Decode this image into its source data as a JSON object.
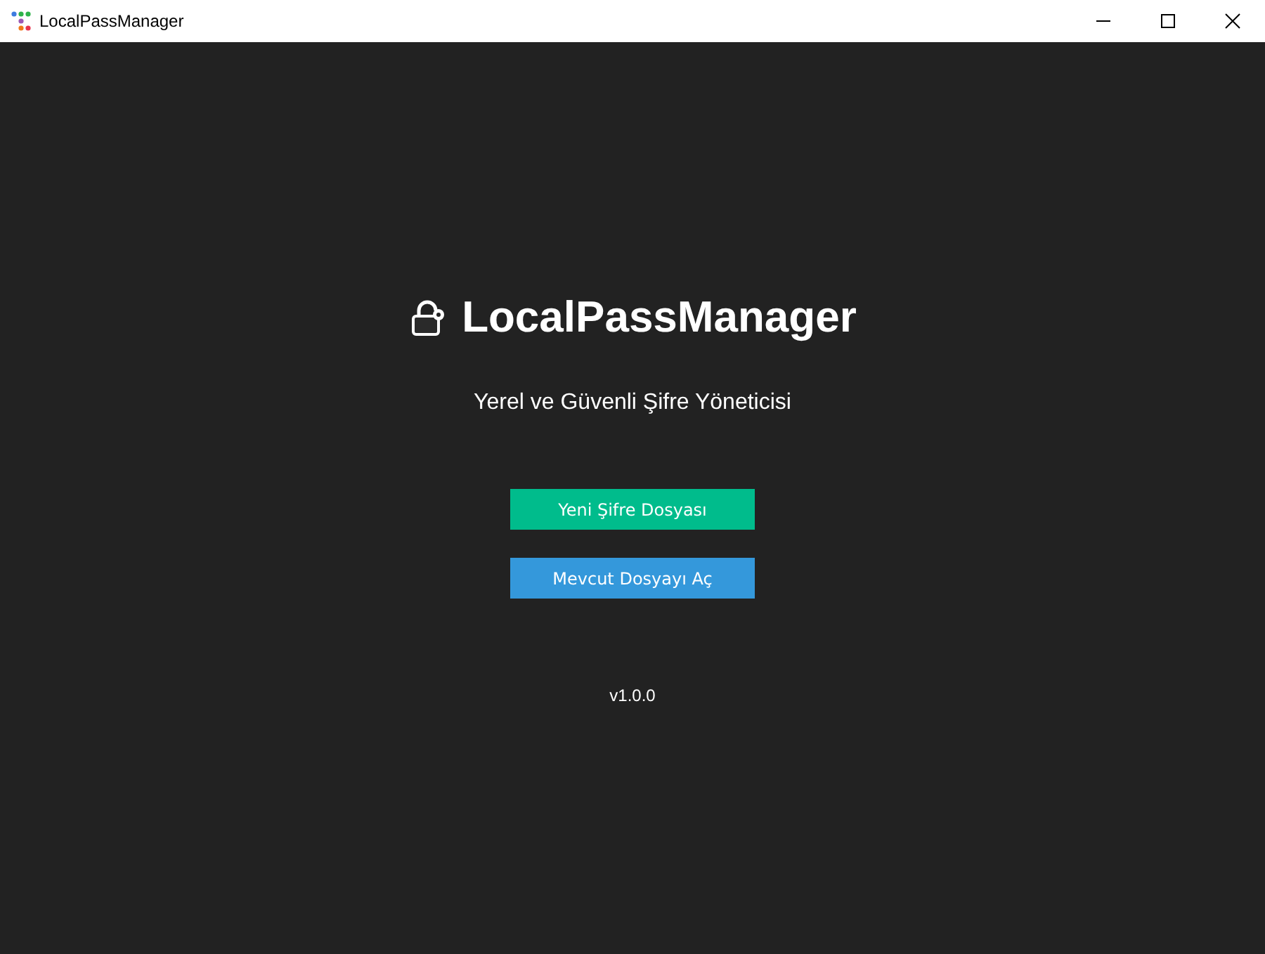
{
  "window": {
    "title": "LocalPassManager"
  },
  "heading": "LocalPassManager",
  "subtitle": "Yerel ve Güvenli Şifre Yöneticisi",
  "buttons": [
    {
      "label": "Yeni Şifre Dosyası",
      "color": "#00bc8c"
    },
    {
      "label": "Mevcut Dosyayı Aç",
      "color": "#3498db"
    }
  ],
  "version": "v1.0.0"
}
